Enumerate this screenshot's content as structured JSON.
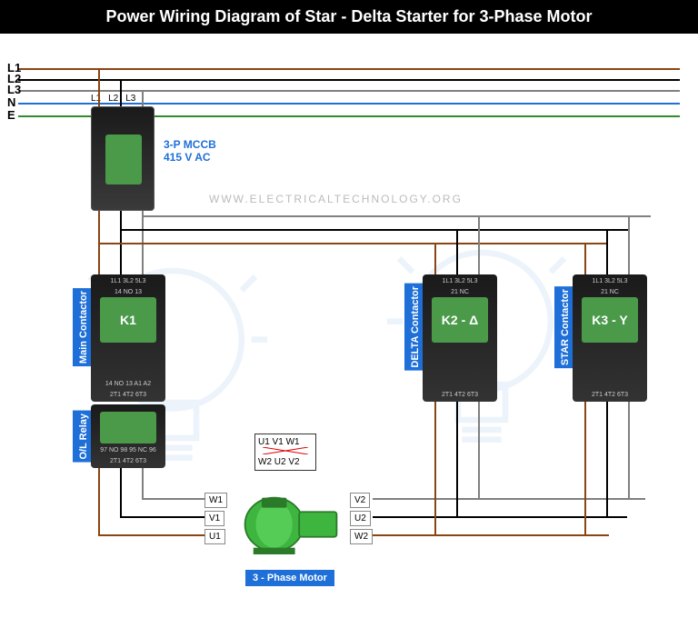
{
  "title": "Power Wiring Diagram of Star - Delta Starter for 3-Phase Motor",
  "bus_lines": [
    {
      "label": "L1",
      "color": "#8B4513",
      "y": 38
    },
    {
      "label": "L2",
      "color": "#000000",
      "y": 50
    },
    {
      "label": "L3",
      "color": "#808080",
      "y": 62
    },
    {
      "label": "N",
      "color": "#1e6fd8",
      "y": 76
    },
    {
      "label": "E",
      "color": "#2e8b2e",
      "y": 90
    }
  ],
  "mccb": {
    "label1": "3-P MCCB",
    "label2": "415 V AC",
    "taps": [
      "L1",
      "L2",
      "L3"
    ]
  },
  "watermark": "WWW.ELECTRICALTECHNOLOGY.ORG",
  "contactors": {
    "main": {
      "label": "Main Contactor",
      "id": "K1",
      "top_terms": "1L1 3L2 5L3",
      "mid_terms1": "14 NO 13",
      "mid_terms2": "14 NO 13 A1 A2",
      "bot_terms": "2T1 4T2 6T3"
    },
    "delta": {
      "label": "DELTA Contactor",
      "id": "K2 - Δ",
      "top_terms": "1L1 3L2 5L3",
      "mid_terms": "21 NC",
      "bot_terms": "2T1 4T2 6T3"
    },
    "star": {
      "label": "STAR Contactor",
      "id": "K3 - Y",
      "top_terms": "1L1 3L2 5L3",
      "mid_terms": "21 NC",
      "bot_terms": "2T1 4T2 6T3"
    }
  },
  "relay": {
    "label": "O/L Relay",
    "terms1": "97 NO 98 95 NC 96",
    "terms2": "2T1 4T2 6T3"
  },
  "motor": {
    "label": "3 - Phase Motor",
    "left_terms": [
      "W1",
      "V1",
      "U1"
    ],
    "right_terms": [
      "V2",
      "U2",
      "W2"
    ]
  },
  "junction": {
    "row1": "U1 V1 W1",
    "row2": "W2 U2 V2"
  }
}
